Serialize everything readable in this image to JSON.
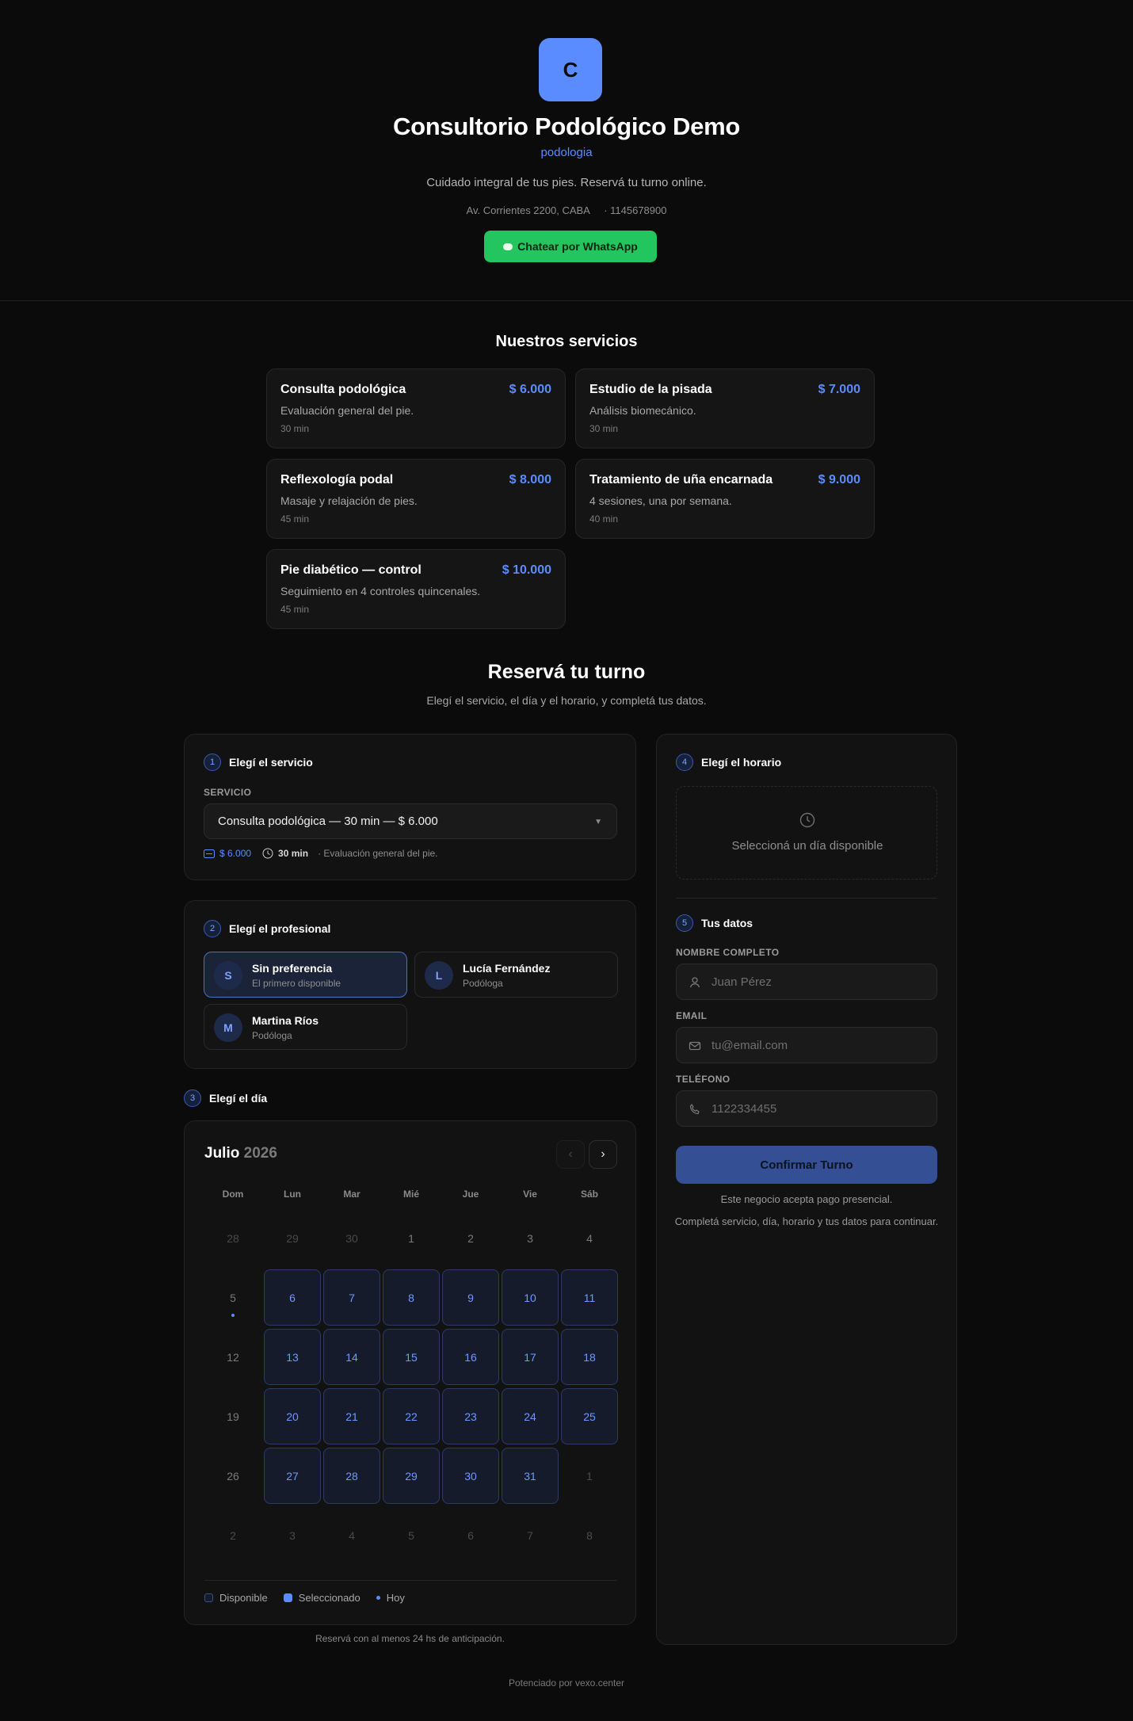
{
  "business": {
    "logo_letter": "C",
    "name": "Consultorio Podológico Demo",
    "category": "podologia",
    "description": "Cuidado integral de tus pies. Reservá tu turno online.",
    "address_line": "Av. Corrientes 2200, CABA     · 1145678900",
    "whatsapp_label": "Chatear por WhatsApp"
  },
  "services_section": {
    "title": "Nuestros servicios",
    "items": [
      {
        "name": "Consulta podológica",
        "price": "$ 6.000",
        "description": "Evaluación general del pie.",
        "duration": "30 min"
      },
      {
        "name": "Estudio de la pisada",
        "price": "$ 7.000",
        "description": "Análisis biomecánico.",
        "duration": "30 min"
      },
      {
        "name": "Reflexología podal",
        "price": "$ 8.000",
        "description": "Masaje y relajación de pies.",
        "duration": "45 min"
      },
      {
        "name": "Tratamiento de uña encarnada",
        "price": "$ 9.000",
        "description": "4 sesiones, una por semana.",
        "duration": "40 min"
      },
      {
        "name": "Pie diabético — control",
        "price": "$ 10.000",
        "description": "Seguimiento en 4 controles quincenales.",
        "duration": "45 min"
      }
    ]
  },
  "booking": {
    "title": "Reservá tu turno",
    "subtitle": "Elegí el servicio, el día y el horario, y completá tus datos.",
    "step1": {
      "num": "1",
      "title": "Elegí el servicio",
      "label": "SERVICIO",
      "selected": "Consulta podológica — 30 min — $ 6.000",
      "price": "$ 6.000",
      "duration": "30 min",
      "description": "· Evaluación general del pie."
    },
    "step2": {
      "num": "2",
      "title": "Elegí el profesional",
      "options": [
        {
          "initial": "S",
          "name": "Sin preferencia",
          "role": "El primero disponible"
        },
        {
          "initial": "L",
          "name": "Lucía Fernández",
          "role": "Podóloga"
        },
        {
          "initial": "M",
          "name": "Martina Ríos",
          "role": "Podóloga"
        }
      ]
    },
    "step3": {
      "num": "3",
      "title": "Elegí el día"
    },
    "calendar": {
      "month": "Julio",
      "year": "2026",
      "weekdays": [
        "Dom",
        "Lun",
        "Mar",
        "Mié",
        "Jue",
        "Vie",
        "Sáb"
      ],
      "weeks": [
        [
          {
            "d": "28",
            "s": "muted"
          },
          {
            "d": "29",
            "s": "muted"
          },
          {
            "d": "30",
            "s": "muted"
          },
          {
            "d": "1",
            "s": "closed"
          },
          {
            "d": "2",
            "s": "closed"
          },
          {
            "d": "3",
            "s": "closed"
          },
          {
            "d": "4",
            "s": "closed"
          }
        ],
        [
          {
            "d": "5",
            "s": "today"
          },
          {
            "d": "6",
            "s": "avail"
          },
          {
            "d": "7",
            "s": "avail"
          },
          {
            "d": "8",
            "s": "avail"
          },
          {
            "d": "9",
            "s": "avail"
          },
          {
            "d": "10",
            "s": "avail"
          },
          {
            "d": "11",
            "s": "avail"
          }
        ],
        [
          {
            "d": "12",
            "s": "closed"
          },
          {
            "d": "13",
            "s": "avail"
          },
          {
            "d": "14",
            "s": "avail"
          },
          {
            "d": "15",
            "s": "avail"
          },
          {
            "d": "16",
            "s": "avail"
          },
          {
            "d": "17",
            "s": "avail"
          },
          {
            "d": "18",
            "s": "avail"
          }
        ],
        [
          {
            "d": "19",
            "s": "closed"
          },
          {
            "d": "20",
            "s": "avail"
          },
          {
            "d": "21",
            "s": "avail"
          },
          {
            "d": "22",
            "s": "avail"
          },
          {
            "d": "23",
            "s": "avail"
          },
          {
            "d": "24",
            "s": "avail"
          },
          {
            "d": "25",
            "s": "avail"
          }
        ],
        [
          {
            "d": "26",
            "s": "closed"
          },
          {
            "d": "27",
            "s": "avail"
          },
          {
            "d": "28",
            "s": "avail"
          },
          {
            "d": "29",
            "s": "avail"
          },
          {
            "d": "30",
            "s": "avail"
          },
          {
            "d": "31",
            "s": "avail"
          },
          {
            "d": "1",
            "s": "muted"
          }
        ],
        [
          {
            "d": "2",
            "s": "muted"
          },
          {
            "d": "3",
            "s": "muted"
          },
          {
            "d": "4",
            "s": "muted"
          },
          {
            "d": "5",
            "s": "muted"
          },
          {
            "d": "6",
            "s": "muted"
          },
          {
            "d": "7",
            "s": "muted"
          },
          {
            "d": "8",
            "s": "muted"
          }
        ]
      ],
      "legend": {
        "available": "Disponible",
        "selected": "Seleccionado",
        "today": "Hoy"
      },
      "note": "Reservá con al menos 24 hs de anticipación."
    },
    "step4": {
      "num": "4",
      "title": "Elegí el horario",
      "empty_text": "Seleccioná un día disponible"
    },
    "step5": {
      "num": "5",
      "title": "Tus datos",
      "name_label": "NOMBRE COMPLETO",
      "name_placeholder": "Juan Pérez",
      "email_label": "EMAIL",
      "email_placeholder": "tu@email.com",
      "phone_label": "TELÉFONO",
      "phone_placeholder": "1122334455"
    },
    "confirm_label": "Confirmar Turno",
    "payment_note": "Este negocio acepta pago presencial.",
    "hint": "Completá servicio, día, horario y tus datos para continuar."
  },
  "footer": {
    "text": "Potenciado por vexo.center"
  },
  "colors": {
    "accent": "#5b8cff",
    "whatsapp": "#22c55e",
    "background": "#0b0b0b"
  },
  "icons": [
    "chat-bubble-icon",
    "ticket-icon",
    "clock-icon",
    "chevron-left-icon",
    "chevron-right-icon",
    "user-icon",
    "mail-icon",
    "phone-icon",
    "caret-down-icon"
  ]
}
